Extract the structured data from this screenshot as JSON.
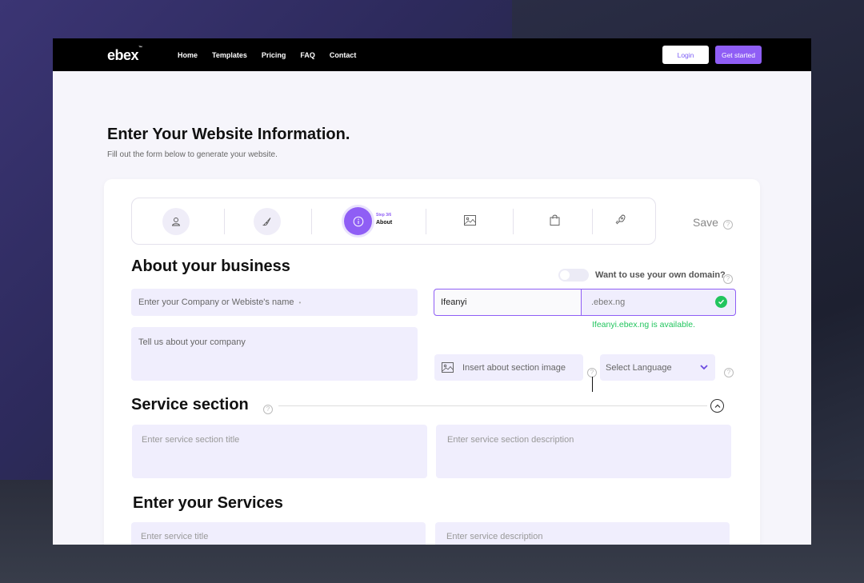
{
  "nav": {
    "logo": "ebex",
    "logo_tm": "™",
    "links": [
      "Home",
      "Templates",
      "Pricing",
      "FAQ",
      "Contact"
    ],
    "login": "Login",
    "get_started": "Get started"
  },
  "header": {
    "title": "Enter Your Website Information.",
    "subtitle": "Fill out the form below  to generate your website."
  },
  "stepper": {
    "step_number": "Step 3/6",
    "step_name": "About",
    "icons": [
      "user-icon",
      "brush-icon",
      "info-icon",
      "image-icon",
      "bag-icon",
      "rocket-icon"
    ],
    "save": "Save"
  },
  "about": {
    "heading": "About your business",
    "domain_toggle_label": "Want to use your own domain?",
    "company_placeholder": "Enter your Company or Webiste's name",
    "description_placeholder": "Tell us about your company",
    "subdomain_value": "Ifeanyi",
    "domain_suffix": ".ebex.ng",
    "availability_message": "Ifeanyi.ebex.ng is available.",
    "image_placeholder": "Insert about section image",
    "language_placeholder": "Select Language"
  },
  "service_section": {
    "heading": "Service section",
    "title_placeholder": "Enter service section title",
    "description_placeholder": "Enter service section description"
  },
  "services": {
    "heading": "Enter your Services",
    "title_placeholder": "Enter service title",
    "description_placeholder": "Enter service description"
  },
  "colors": {
    "accent": "#8f5ef5",
    "success": "#22c55e",
    "field_bg": "#f0eefd"
  }
}
